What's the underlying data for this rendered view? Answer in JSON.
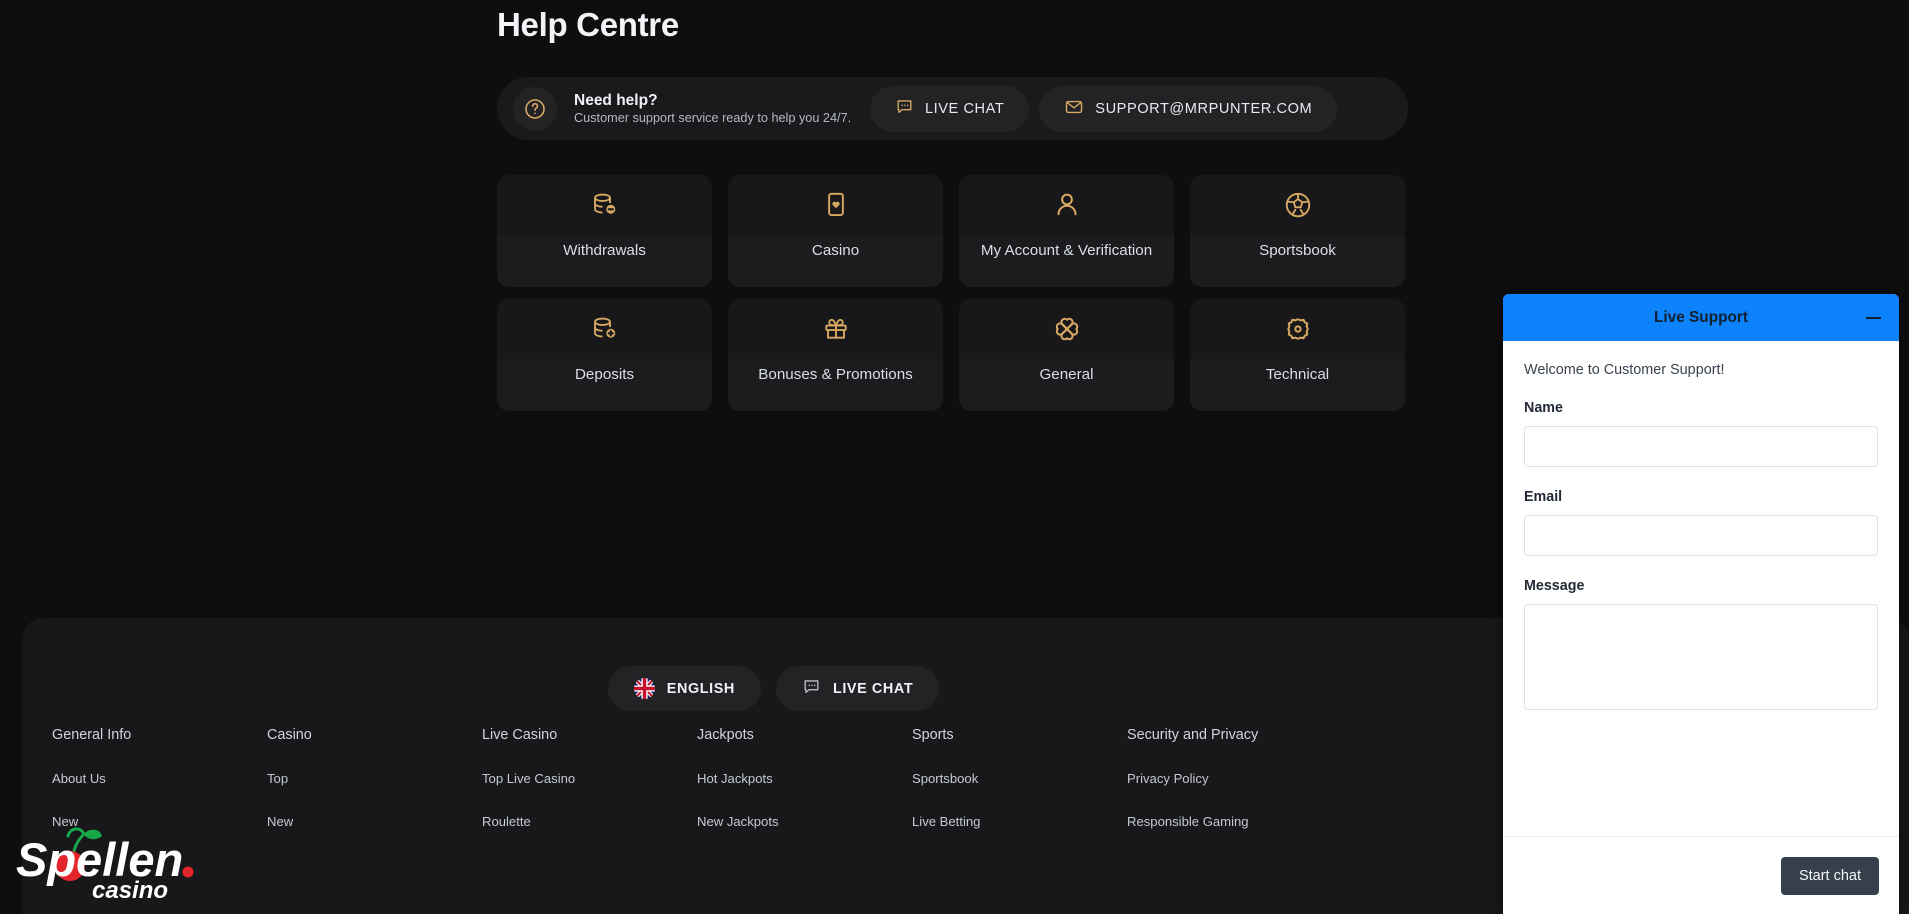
{
  "page": {
    "title": "Help Centre",
    "background": "#0e0e0f",
    "accent_gold": "#d7a963",
    "accent_blue": "#0d82fd"
  },
  "need_help": {
    "icon": "question-mark-circle-icon",
    "title": "Need help?",
    "subtitle": "Customer support service ready to help you 24/7.",
    "actions": [
      {
        "icon": "chat-bubble-icon",
        "label": "LIVE CHAT"
      },
      {
        "icon": "envelope-icon",
        "label": "SUPPORT@MRPUNTER.COM"
      }
    ]
  },
  "categories": [
    {
      "icon": "database-minus-icon",
      "label": "Withdrawals"
    },
    {
      "icon": "playing-card-heart-icon",
      "label": "Casino"
    },
    {
      "icon": "user-icon",
      "label": "My Account & Verification"
    },
    {
      "icon": "football-icon",
      "label": "Sportsbook"
    },
    {
      "icon": "database-plus-icon",
      "label": "Deposits"
    },
    {
      "icon": "gift-icon",
      "label": "Bonuses & Promotions"
    },
    {
      "icon": "clover-icon",
      "label": "General"
    },
    {
      "icon": "gear-icon",
      "label": "Technical"
    }
  ],
  "footer": {
    "pills": [
      {
        "icon": "uk-flag-icon",
        "label": "ENGLISH"
      },
      {
        "icon": "chat-bubble-icon",
        "label": "LIVE CHAT"
      }
    ],
    "columns": [
      {
        "title": "General Info",
        "links": [
          "About Us",
          "New"
        ]
      },
      {
        "title": "Casino",
        "links": [
          "Top",
          "New"
        ]
      },
      {
        "title": "Live Casino",
        "links": [
          "Top Live Casino",
          "Roulette"
        ]
      },
      {
        "title": "Jackpots",
        "links": [
          "Hot Jackpots",
          "New Jackpots"
        ]
      },
      {
        "title": "Sports",
        "links": [
          "Sportsbook",
          "Live Betting"
        ]
      },
      {
        "title": "Security and Privacy",
        "links": [
          "Privacy Policy",
          "Responsible Gaming"
        ]
      }
    ],
    "logo": {
      "name": "Spellen",
      "suffix": "casino",
      "dot": "."
    }
  },
  "chat_widget": {
    "title": "Live Support",
    "minimize_icon": "minimize-icon",
    "welcome": "Welcome to Customer Support!",
    "fields": [
      {
        "label": "Name",
        "value": "",
        "placeholder": ""
      },
      {
        "label": "Email",
        "value": "",
        "placeholder": ""
      },
      {
        "label": "Message",
        "value": "",
        "placeholder": ""
      }
    ],
    "submit_label": "Start chat"
  }
}
